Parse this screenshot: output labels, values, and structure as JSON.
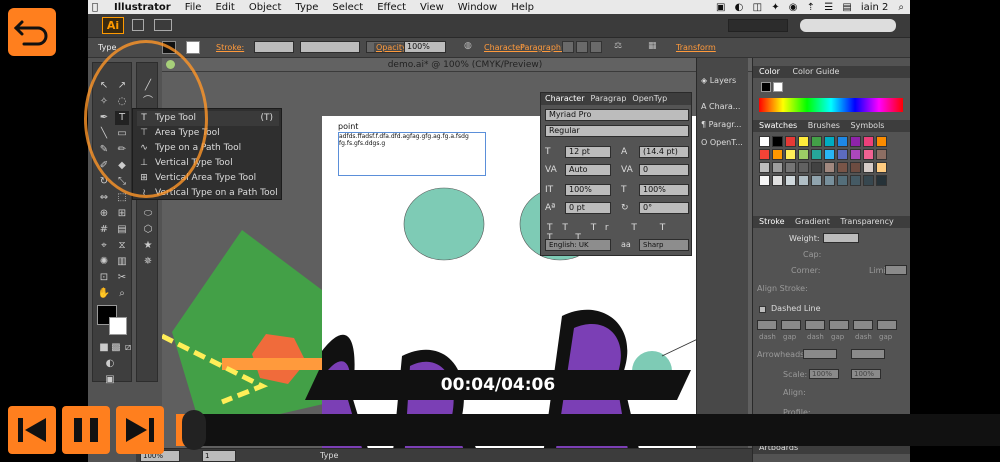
{
  "menubar": {
    "app_name": "Illustrator",
    "items": [
      "File",
      "Edit",
      "Object",
      "Type",
      "Select",
      "Effect",
      "View",
      "Window",
      "Help"
    ],
    "user": "iain 2"
  },
  "appbar": {
    "logo": "Ai"
  },
  "control_bar": {
    "selection_label": "Type",
    "stroke_label": "Stroke:",
    "opacity_label": "Opacity:",
    "opacity_value": "100%",
    "character_link": "Character",
    "paragraph_link": "Paragraph:",
    "transform_link": "Transform"
  },
  "document": {
    "tab_title": "demo.ai* @ 100% (CMYK/Preview)"
  },
  "artboard": {
    "text_line1": "point",
    "text_line2": "adfds.ffadsf.f.dfa.dfd.agfag.gfg.ag.fg.a.fsdg",
    "text_line3": "fg.fs.gfs.ddgs.g"
  },
  "type_flyout": {
    "items": [
      {
        "label": "Type Tool",
        "shortcut": "(T)",
        "icon": "type-icon"
      },
      {
        "label": "Area Type Tool",
        "shortcut": "",
        "icon": "area-type-icon"
      },
      {
        "label": "Type on a Path Tool",
        "shortcut": "",
        "icon": "path-type-icon"
      },
      {
        "label": "Vertical Type Tool",
        "shortcut": "",
        "icon": "vertical-type-icon"
      },
      {
        "label": "Vertical Area Type Tool",
        "shortcut": "",
        "icon": "vertical-area-type-icon"
      },
      {
        "label": "Vertical Type on a Path Tool",
        "shortcut": "",
        "icon": "vertical-path-type-icon"
      }
    ]
  },
  "character_panel": {
    "tabs": [
      "Character",
      "Paragrap",
      "OpenTyp"
    ],
    "font_family": "Myriad Pro",
    "font_style": "Regular",
    "font_size": "12 pt",
    "leading": "(14.4 pt)",
    "kerning": "Auto",
    "tracking": "0",
    "vertical_scale": "100%",
    "horizontal_scale": "100%",
    "baseline_shift": "0 pt",
    "rotation": "0°",
    "language": "English: UK",
    "antialias_prefix": "aa",
    "antialias": "Sharp"
  },
  "dock": {
    "items": [
      "Layers",
      "Chara...",
      "Paragr...",
      "OpenT..."
    ]
  },
  "right_panel": {
    "color_tabs": [
      "Color",
      "Color Guide"
    ],
    "swatch_tabs": [
      "Swatches",
      "Brushes",
      "Symbols"
    ],
    "stroke_tabs": [
      "Stroke",
      "Gradient",
      "Transparency"
    ],
    "weight_label": "Weight:",
    "cap_label": "Cap:",
    "corner_label": "Corner:",
    "limit_label": "Limit:",
    "align_stroke_label": "Align Stroke:",
    "dashed_line_label": "Dashed Line",
    "dash_labels": [
      "dash",
      "gap",
      "dash",
      "gap",
      "dash",
      "gap"
    ],
    "arrowheads_label": "Arrowheads:",
    "scale_label": "Scale:",
    "scale_values": [
      "100%",
      "100%"
    ],
    "align_label": "Align:",
    "profile_label": "Profile:",
    "artboards_label": "Artboards"
  },
  "status_bar": {
    "zoom": "100%",
    "page": "1",
    "tool": "Type"
  },
  "video": {
    "timecode": "00:04/04:06",
    "progress": 0.016
  },
  "colors": {
    "accent": "#ff7f1e",
    "teal": "#7ecbb5",
    "purple": "#7b3fb5",
    "green": "#43a047"
  }
}
